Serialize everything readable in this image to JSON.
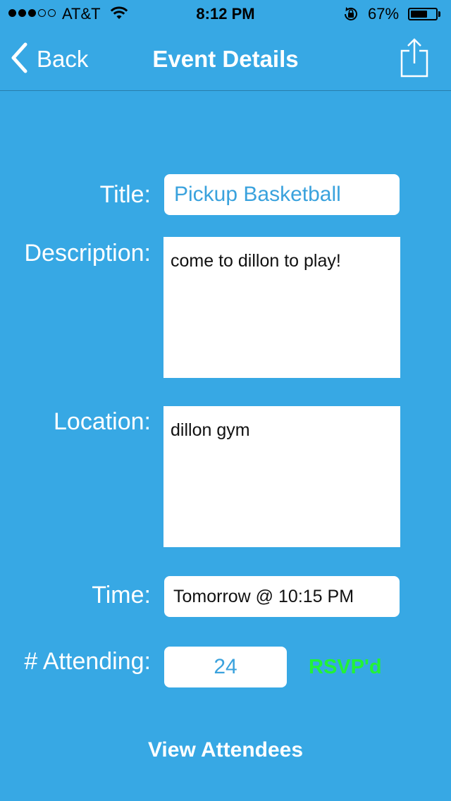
{
  "status_bar": {
    "signal_filled": 3,
    "signal_total": 5,
    "carrier": "AT&T",
    "time": "8:12 PM",
    "battery_percent_label": "67%",
    "battery_level": 0.67,
    "icons": [
      "wifi-icon",
      "rotation-lock-icon",
      "battery-icon"
    ]
  },
  "nav": {
    "back_label": "Back",
    "title": "Event Details",
    "back_icon": "chevron-left-icon",
    "share_icon": "share-icon"
  },
  "form": {
    "title_label": "Title:",
    "title_value": "Pickup Basketball",
    "description_label": "Description:",
    "description_value": "come to dillon to play!",
    "location_label": "Location:",
    "location_value": "dillon gym",
    "time_label": "Time:",
    "time_value": "Tomorrow @ 10:15 PM",
    "attending_label": "# Attending:",
    "attending_value": "24",
    "rsvp_label": "RSVP'd"
  },
  "footer": {
    "view_attendees_label": "View Attendees"
  },
  "colors": {
    "background": "#37a8e4",
    "accent_text": "#3aa2dd",
    "rsvp": "#22f236"
  }
}
